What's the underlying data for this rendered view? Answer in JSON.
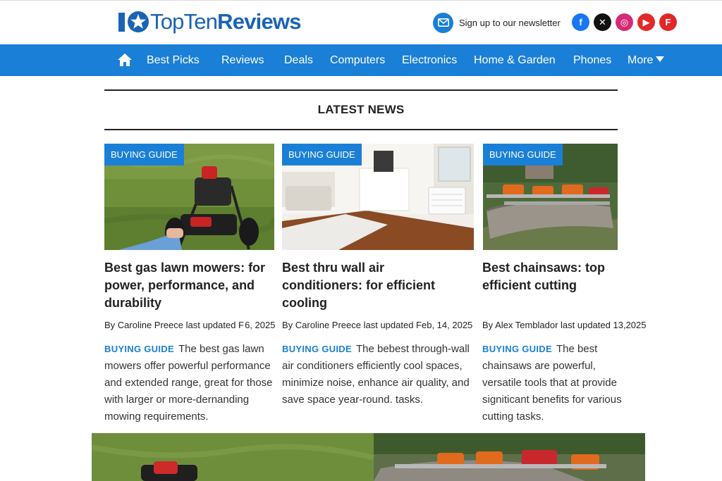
{
  "header": {
    "logo_light": "TopTen",
    "logo_bold": "Reviews",
    "newsletter_label": "Sign up to our newsletter",
    "socials": [
      {
        "icon": "facebook-icon",
        "glyph": "f",
        "color": "#1877f2"
      },
      {
        "icon": "x-icon",
        "glyph": "✕",
        "color": "#111111"
      },
      {
        "icon": "instagram-icon",
        "glyph": "◎",
        "color": "#d62976"
      },
      {
        "icon": "youtube-icon",
        "glyph": "▶",
        "color": "#e32929"
      },
      {
        "icon": "flipboard-icon",
        "glyph": "F",
        "color": "#e12828"
      }
    ]
  },
  "nav": {
    "items": [
      "Best Picks",
      "Reviews",
      "Deals",
      "Computers",
      "Electronics",
      "Home & Garden",
      "Phones",
      "More"
    ]
  },
  "section": {
    "title": "LATEST NEWS"
  },
  "cards": [
    {
      "tag": "BUYING GUIDE",
      "title": "Best gas lawn mowers: for power, performance, and durability",
      "byline": "By Caroline Preece last updated F 6, 2025",
      "kicker": "BUYING GUIDE",
      "desc": "The best gas lawn mowers offer powerful performance and extended range, great for those with larger or more-dernanding mowing requirements."
    },
    {
      "tag": "BUYING GUIDE",
      "title": "Best thru wall air conditioners: for efficient cooling",
      "byline": "By Caroline Preece last updated Feb, 14, 2025",
      "kicker": "BUYING GUIDE",
      "desc": "The bebest through-wall air conditioners efficiently cool spaces, minimize noise, enhance air quality, and save space year-round. tasks."
    },
    {
      "tag": "BUYING GUIDE",
      "title": "Best chainsaws: top efficient cutting",
      "byline": "By Alex Temblador last updated 13,2025",
      "kicker": "BUYING GUIDE",
      "desc": "The best chainsaws are powerful, versatile tools that at provide signiticant benefits for various cutting tasks."
    }
  ],
  "colors": {
    "brand_blue": "#1a7fd6",
    "logo_blue": "#1a63b5",
    "text": "#222222"
  }
}
